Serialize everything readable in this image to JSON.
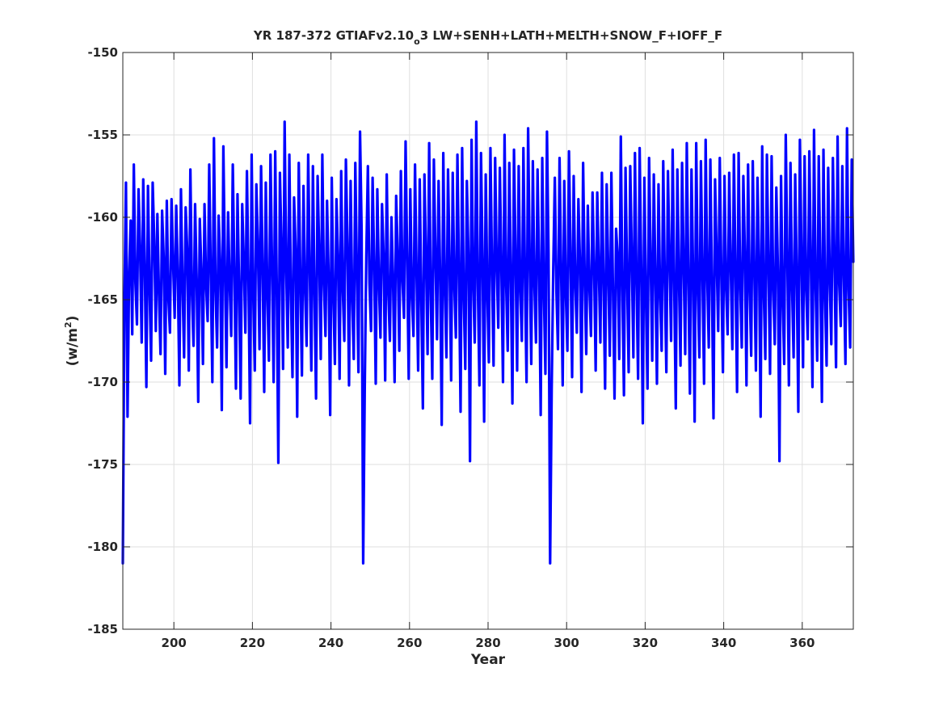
{
  "chart_data": {
    "type": "line",
    "title": {
      "before_sub": "YR 187-372 GTIAFv2.10",
      "subscript": "o",
      "after_sub": "3 LW+SENH+LATH+MELTH+SNOW_F+IOFF_F"
    },
    "xlabel": "Year",
    "ylabel": {
      "before_sup": "(w/m",
      "superscript": "2",
      "after_sup": ")"
    },
    "xlim": [
      187,
      373
    ],
    "ylim": [
      -185,
      -150
    ],
    "xticks": [
      200,
      220,
      240,
      260,
      280,
      300,
      320,
      340,
      360
    ],
    "yticks": [
      -150,
      -155,
      -160,
      -165,
      -170,
      -175,
      -180,
      -185
    ],
    "xtick_labels": [
      "200",
      "220",
      "240",
      "260",
      "280",
      "300",
      "320",
      "340",
      "360"
    ],
    "ytick_labels": [
      "-150",
      "-155",
      "-160",
      "-165",
      "-170",
      "-175",
      "-180",
      "-185"
    ],
    "grid": true,
    "series": [
      {
        "color": "#0000ff",
        "line_width": "thick",
        "samples_per_year": 4,
        "x_start": 187,
        "x_end": 373,
        "values": [
          -181.0,
          -165.2,
          -157.9,
          -172.1,
          -163.4,
          -160.2,
          -167.1,
          -156.8,
          -163.9,
          -166.5,
          -158.3,
          -161.9,
          -167.6,
          -157.7,
          -163.1,
          -170.3,
          -158.1,
          -164.2,
          -168.7,
          -157.9,
          -161.4,
          -166.9,
          -159.8,
          -164.7,
          -168.3,
          -159.6,
          -162.4,
          -169.5,
          -159.0,
          -164.9,
          -167.0,
          -158.9,
          -162.7,
          -166.1,
          -159.3,
          -163.5,
          -170.2,
          -158.3,
          -164.0,
          -168.5,
          -159.4,
          -162.0,
          -169.3,
          -157.1,
          -164.6,
          -167.8,
          -159.2,
          -163.7,
          -171.2,
          -160.1,
          -163.3,
          -168.9,
          -159.2,
          -164.1,
          -166.3,
          -156.8,
          -163.6,
          -170.0,
          -155.2,
          -164.4,
          -167.9,
          -159.9,
          -162.8,
          -171.7,
          -155.7,
          -163.1,
          -169.1,
          -159.7,
          -164.0,
          -167.2,
          -156.8,
          -163.3,
          -170.4,
          -158.6,
          -164.2,
          -171.0,
          -159.2,
          -162.6,
          -167.0,
          -157.2,
          -163.9,
          -172.5,
          -156.2,
          -164.5,
          -169.3,
          -158.0,
          -161.7,
          -168.0,
          -156.9,
          -163.0,
          -170.6,
          -157.9,
          -164.6,
          -168.7,
          -156.2,
          -163.1,
          -170.0,
          -156.0,
          -164.3,
          -174.9,
          -157.3,
          -161.8,
          -169.2,
          -154.2,
          -163.1,
          -167.9,
          -156.2,
          -164.7,
          -169.7,
          -158.8,
          -161.9,
          -172.1,
          -156.7,
          -163.8,
          -169.6,
          -158.1,
          -164.3,
          -167.8,
          -156.2,
          -163.2,
          -169.3,
          -156.9,
          -164.5,
          -171.0,
          -157.5,
          -162.1,
          -168.6,
          -156.2,
          -164.0,
          -167.2,
          -159.0,
          -163.6,
          -172.0,
          -157.6,
          -164.7,
          -168.9,
          -158.9,
          -162.5,
          -169.8,
          -157.2,
          -164.3,
          -167.5,
          -156.5,
          -161.6,
          -170.2,
          -157.8,
          -164.9,
          -168.6,
          -156.7,
          -163.4,
          -169.4,
          -154.8,
          -160.8,
          -181.0,
          -170.4,
          -162.3,
          -156.9,
          -164.0,
          -166.9,
          -157.6,
          -162.8,
          -170.1,
          -158.3,
          -163.9,
          -167.3,
          -159.2,
          -162.3,
          -169.9,
          -157.4,
          -164.5,
          -167.5,
          -160.0,
          -163.7,
          -170.0,
          -158.7,
          -162.4,
          -168.1,
          -157.2,
          -163.8,
          -166.1,
          -155.4,
          -162.6,
          -169.8,
          -158.3,
          -164.7,
          -167.2,
          -156.8,
          -163.5,
          -169.3,
          -157.7,
          -164.9,
          -171.6,
          -157.4,
          -162.5,
          -168.3,
          -155.5,
          -164.7,
          -169.8,
          -156.5,
          -162.3,
          -167.4,
          -157.8,
          -163.6,
          -172.6,
          -156.1,
          -164.2,
          -168.5,
          -157.1,
          -162.8,
          -169.9,
          -157.3,
          -164.1,
          -167.3,
          -156.2,
          -163.4,
          -171.8,
          -155.8,
          -164.7,
          -169.2,
          -157.8,
          -162.3,
          -174.8,
          -155.3,
          -163.7,
          -167.6,
          -154.2,
          -164.1,
          -170.2,
          -156.1,
          -162.5,
          -172.4,
          -157.4,
          -164.4,
          -168.8,
          -155.8,
          -163.1,
          -169.0,
          -156.4,
          -162.9,
          -166.7,
          -157.0,
          -163.2,
          -170.0,
          -155.0,
          -164.0,
          -168.1,
          -156.7,
          -163.6,
          -171.3,
          -155.9,
          -162.4,
          -169.3,
          -156.9,
          -164.4,
          -167.5,
          -155.8,
          -163.8,
          -170.0,
          -154.6,
          -162.6,
          -168.9,
          -156.6,
          -164.1,
          -167.6,
          -157.1,
          -163.1,
          -172.0,
          -156.4,
          -164.4,
          -169.5,
          -154.8,
          -162.2,
          -181.0,
          -170.4,
          -163.1,
          -157.6,
          -164.5,
          -168.0,
          -156.4,
          -163.2,
          -170.2,
          -157.8,
          -164.6,
          -168.1,
          -156.0,
          -162.4,
          -169.7,
          -157.5,
          -164.0,
          -167.0,
          -158.9,
          -162.7,
          -170.6,
          -156.7,
          -163.6,
          -168.3,
          -159.3,
          -164.2,
          -167.2,
          -158.5,
          -163.0,
          -169.3,
          -158.5,
          -163.1,
          -167.6,
          -157.3,
          -164.0,
          -170.4,
          -158.0,
          -163.3,
          -168.4,
          -157.3,
          -164.3,
          -171.0,
          -160.7,
          -162.4,
          -168.6,
          -155.1,
          -164.3,
          -170.8,
          -157.0,
          -163.6,
          -169.4,
          -156.9,
          -162.4,
          -168.5,
          -156.1,
          -164.0,
          -169.8,
          -155.8,
          -163.3,
          -172.5,
          -157.6,
          -164.8,
          -170.4,
          -156.4,
          -162.6,
          -168.7,
          -157.4,
          -163.6,
          -170.1,
          -158.0,
          -164.6,
          -168.1,
          -156.6,
          -163.9,
          -169.4,
          -157.2,
          -162.5,
          -167.5,
          -155.9,
          -164.1,
          -171.6,
          -157.1,
          -163.6,
          -169.0,
          -156.7,
          -162.9,
          -168.3,
          -155.5,
          -164.0,
          -170.7,
          -157.1,
          -163.3,
          -172.4,
          -155.5,
          -164.2,
          -168.5,
          -156.6,
          -163.5,
          -170.1,
          -155.3,
          -163.5,
          -167.9,
          -156.5,
          -164.1,
          -172.2,
          -157.7,
          -162.4,
          -166.9,
          -156.4,
          -163.7,
          -169.4,
          -157.5,
          -164.2,
          -167.1,
          -157.3,
          -163.1,
          -168.0,
          -156.2,
          -163.4,
          -170.6,
          -156.1,
          -164.0,
          -167.9,
          -157.5,
          -162.3,
          -170.2,
          -156.8,
          -164.2,
          -168.4,
          -156.6,
          -163.3,
          -169.3,
          -157.6,
          -162.7,
          -172.1,
          -155.7,
          -164.5,
          -168.6,
          -156.2,
          -163.0,
          -169.5,
          -156.3,
          -164.3,
          -167.7,
          -158.2,
          -163.2,
          -174.8,
          -157.5,
          -164.6,
          -168.9,
          -155.0,
          -162.5,
          -170.2,
          -156.7,
          -164.1,
          -168.5,
          -157.4,
          -163.6,
          -171.8,
          -155.3,
          -162.4,
          -169.1,
          -156.3,
          -164.4,
          -167.4,
          -156.0,
          -162.8,
          -170.3,
          -154.7,
          -164.2,
          -168.7,
          -156.3,
          -163.2,
          -171.2,
          -155.9,
          -164.7,
          -169.0,
          -157.0,
          -163.8,
          -167.7,
          -156.4,
          -162.6,
          -169.1,
          -155.1,
          -164.0,
          -166.6,
          -156.9,
          -163.7,
          -168.9,
          -154.6,
          -164.4,
          -167.9,
          -156.5,
          -162.7
        ]
      }
    ]
  }
}
